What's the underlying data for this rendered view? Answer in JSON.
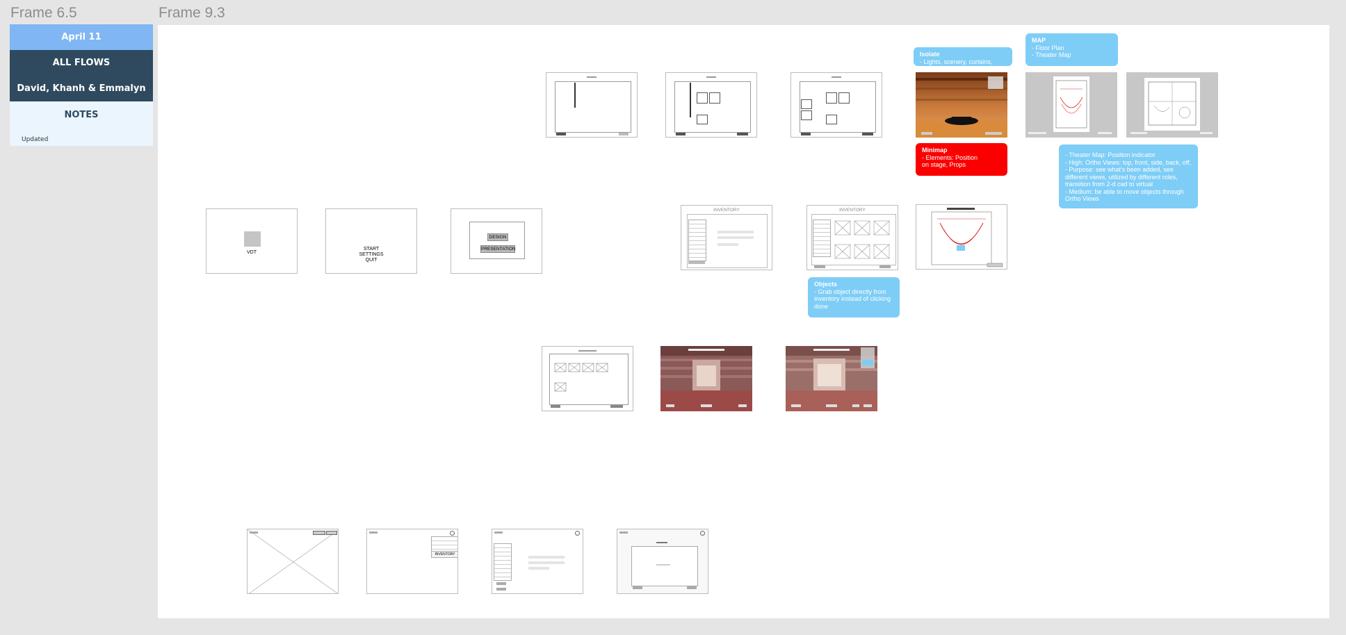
{
  "frames": {
    "left_label": "Frame 6.5",
    "main_label": "Frame 9.3"
  },
  "left_panel": {
    "date": "April 11",
    "flows": "ALL FLOWS",
    "authors": "David, Khanh & Emmalyn",
    "notes_title": "NOTES",
    "notes_text": "Updated"
  },
  "wireframes": {
    "vdt_label": "VDT",
    "start_menu": [
      "START",
      "SETTINGS",
      "QUIT"
    ],
    "design_button": "DESIGN",
    "presentation_button": "PRESENTATION",
    "inventory_title": "INVENTORY",
    "inventory_title_2": "INVENTORY",
    "inventory_label": "INVENTORY"
  },
  "notes": {
    "isolate": {
      "title": "Isolate",
      "body": "- Lights, scenery, curtains, props"
    },
    "map": {
      "title": "MAP",
      "body": "- Floor Plan\n- Theater Map"
    },
    "minimap": {
      "title": "Minimap",
      "body": "- Elements: Position\non stage, Props"
    },
    "objects": {
      "title": "Objects",
      "body": "- Grab object directly from\ninventory instead of clicking\ndone"
    },
    "theater_map": {
      "body": "- Theater Map: Position indicator\n- High: Ortho Views: top, front, side, back, off,\n  - Purpose: see what's been added, see\ndifferent views, utilized by different roles,\ntransition from 2-d cad to virtual\n- Medium: be able to move objects through\nOrtho Views"
    }
  },
  "colors": {
    "canvas_bg": "#e5e5e5",
    "accent_blue": "#7ecdf6",
    "alert_red": "#fb0000",
    "nav_dark": "#2f4a5f",
    "nav_light": "#7fb6f3"
  }
}
